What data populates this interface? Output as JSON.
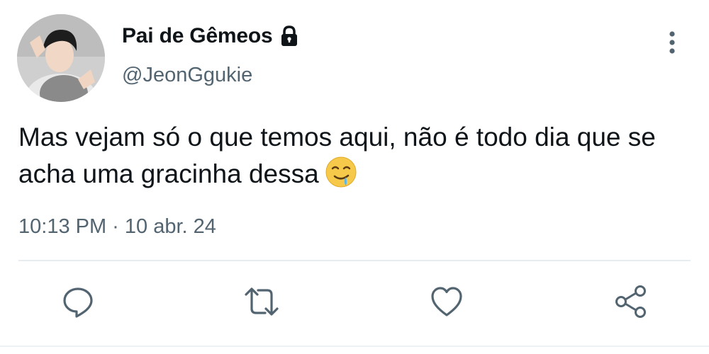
{
  "tweet": {
    "author": {
      "display_name": "Pai de Gêmeos",
      "handle": "@JeonGgukie",
      "protected_icon": "lock-icon",
      "avatar": "profile-photo"
    },
    "text": "Mas vejam só o que temos aqui, não é todo dia que se acha uma gracinha dessa",
    "emoji": "drooling-face-emoji",
    "timestamp": "10:13 PM · 10 abr. 24",
    "menu_icon": "more-vertical-icon"
  },
  "actions": [
    {
      "name": "reply",
      "icon": "reply-icon"
    },
    {
      "name": "retweet",
      "icon": "retweet-icon"
    },
    {
      "name": "like",
      "icon": "heart-icon"
    },
    {
      "name": "share",
      "icon": "share-icon"
    }
  ],
  "colors": {
    "text_primary": "#0f1419",
    "text_secondary": "#536471",
    "icon": "#536471",
    "divider": "#e6ecf0",
    "background": "#ffffff"
  }
}
